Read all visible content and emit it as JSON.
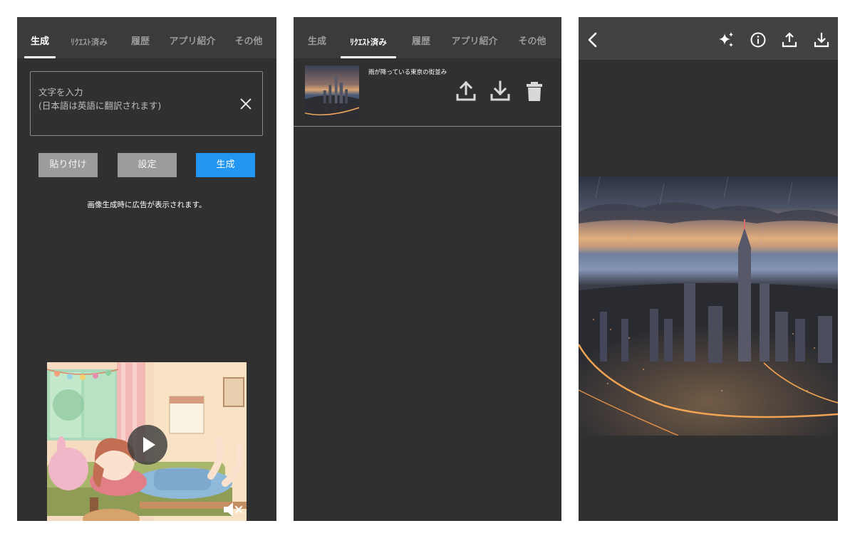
{
  "screen1": {
    "tabs": [
      {
        "label": "生成",
        "active": true
      },
      {
        "label": "ﾘｸｴｽﾄ済み",
        "active": false
      },
      {
        "label": "履歴",
        "active": false
      },
      {
        "label": "アプリ紹介",
        "active": false
      },
      {
        "label": "その他",
        "active": false
      }
    ],
    "prompt_placeholder": "文字を入力\n(日本語は英語に翻訳されます)",
    "buttons": {
      "paste": "貼り付け",
      "settings": "設定",
      "generate": "生成"
    },
    "ad_notice": "画像生成時に広告が表示されます。"
  },
  "screen2": {
    "tabs": [
      {
        "label": "生成",
        "active": false
      },
      {
        "label": "ﾘｸｴｽﾄ済み",
        "active": true
      },
      {
        "label": "履歴",
        "active": false
      },
      {
        "label": "アプリ紹介",
        "active": false
      },
      {
        "label": "その他",
        "active": false
      }
    ],
    "requests": [
      {
        "prompt": "雨が降っている東京の街並み"
      }
    ]
  },
  "screen3": {
    "toolbar_icons": [
      "back-icon",
      "sparkle-icon",
      "info-icon",
      "share-icon",
      "download-icon"
    ]
  },
  "colors": {
    "background": "#303030",
    "tabbar": "#3b3b3b",
    "accent_blue": "#2196f3",
    "button_gray": "#9c9c9c"
  }
}
